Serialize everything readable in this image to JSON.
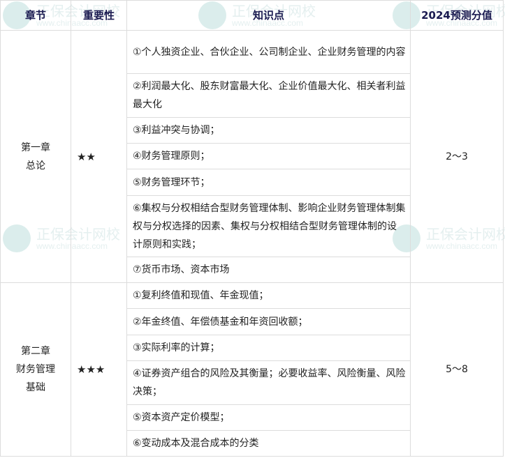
{
  "headers": [
    "章节",
    "重要性",
    "知识点",
    "2024预测分值"
  ],
  "chapters": [
    {
      "name_lines": [
        "第一章",
        "总论"
      ],
      "importance": "★★",
      "score": "2～3",
      "points": [
        "①个人独资企业、合伙企业、公司制企业、企业财务管理的内容",
        "②利润最大化、股东财富最大化、企业价值最大化、相关者利益最大化",
        "③利益冲突与协调；",
        "④财务管理原则；",
        "⑤财务管理环节；",
        "⑥集权与分权相结合型财务管理体制、影响企业财务管理体制集权与分权选择的因素、集权与分权相结合型财务管理体制的设计原则和实践；",
        "⑦货币市场、资本市场"
      ]
    },
    {
      "name_lines": [
        "第二章",
        "财务管理",
        "基础"
      ],
      "importance": "★★★",
      "score": "5～8",
      "points": [
        "①复利终值和现值、年金现值；",
        "②年金终值、年偿债基金和年资回收额；",
        "③实际利率的计算；",
        "④证券资产组合的风险及其衡量；必要收益率、风险衡量、风险决策；",
        "⑤资本资产定价模型；",
        "⑥变动成本及混合成本的分类"
      ]
    }
  ],
  "watermark": {
    "name": "正保会计网校",
    "url": "www.chinaacc.com"
  }
}
